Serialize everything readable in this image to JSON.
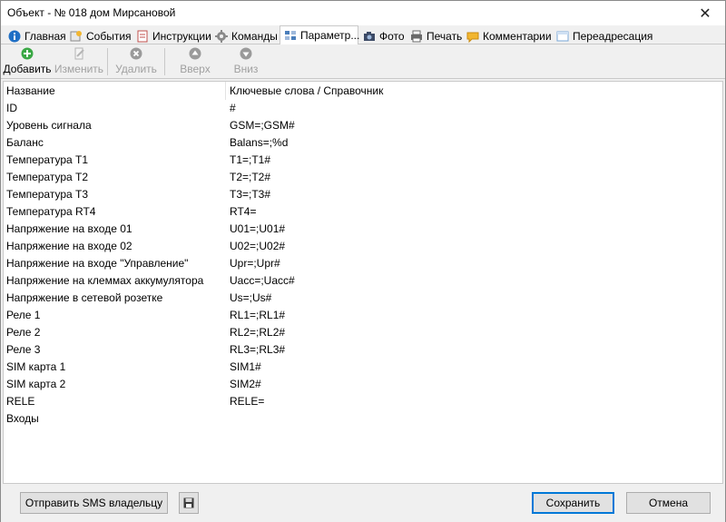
{
  "window": {
    "title": "Объект - № 018 дом Мирсановой",
    "close_symbol": "✕"
  },
  "tabs": [
    {
      "label": "Главная",
      "icon": "info-icon"
    },
    {
      "label": "События",
      "icon": "events-icon"
    },
    {
      "label": "Инструкции",
      "icon": "instructions-icon"
    },
    {
      "label": "Команды",
      "icon": "gear-icon"
    },
    {
      "label": "Параметр...",
      "icon": "parameters-icon",
      "active": true
    },
    {
      "label": "Фото",
      "icon": "camera-icon"
    },
    {
      "label": "Печать",
      "icon": "printer-icon"
    },
    {
      "label": "Комментарии",
      "icon": "comment-icon"
    },
    {
      "label": "Переадресация",
      "icon": "redirect-icon"
    }
  ],
  "toolbar": {
    "add_label": "Добавить",
    "edit_label": "Изменить",
    "delete_label": "Удалить",
    "up_label": "Вверх",
    "down_label": "Вниз"
  },
  "grid": {
    "columns": [
      "Название",
      "Ключевые слова / Справочник"
    ],
    "rows": [
      [
        "ID",
        "#"
      ],
      [
        "Уровень сигнала",
        "GSM=;GSM#"
      ],
      [
        "Баланс",
        "Balans=;%d"
      ],
      [
        "Температура Т1",
        "T1=;T1#"
      ],
      [
        "Температура Т2",
        "T2=;T2#"
      ],
      [
        "Температура Т3",
        "T3=;T3#"
      ],
      [
        "Температура RT4",
        "RT4="
      ],
      [
        "Напряжение на входе 01",
        "U01=;U01#"
      ],
      [
        "Напряжение на входе 02",
        "U02=;U02#"
      ],
      [
        "Напряжение на входе \"Управление\"",
        "Upr=;Upr#"
      ],
      [
        "Напряжение на клеммах аккумулятора",
        "Uacc=;Uacc#"
      ],
      [
        "Напряжение в сетевой розетке",
        "Us=;Us#"
      ],
      [
        "Реле 1",
        "RL1=;RL1#"
      ],
      [
        "Реле 2",
        "RL2=;RL2#"
      ],
      [
        "Реле 3",
        "RL3=;RL3#"
      ],
      [
        "SIM карта 1",
        "SIM1#"
      ],
      [
        "SIM карта 2",
        "SIM2#"
      ],
      [
        "RELE",
        "RELE="
      ],
      [
        "Входы",
        ""
      ]
    ]
  },
  "footer": {
    "send_sms_label": "Отправить SMS владельцу",
    "save_label": "Сохранить",
    "cancel_label": "Отмена"
  },
  "colors": {
    "add_green": "#3aa845",
    "disabled_gray": "#a0a0a0",
    "focus_blue": "#0078d7"
  }
}
